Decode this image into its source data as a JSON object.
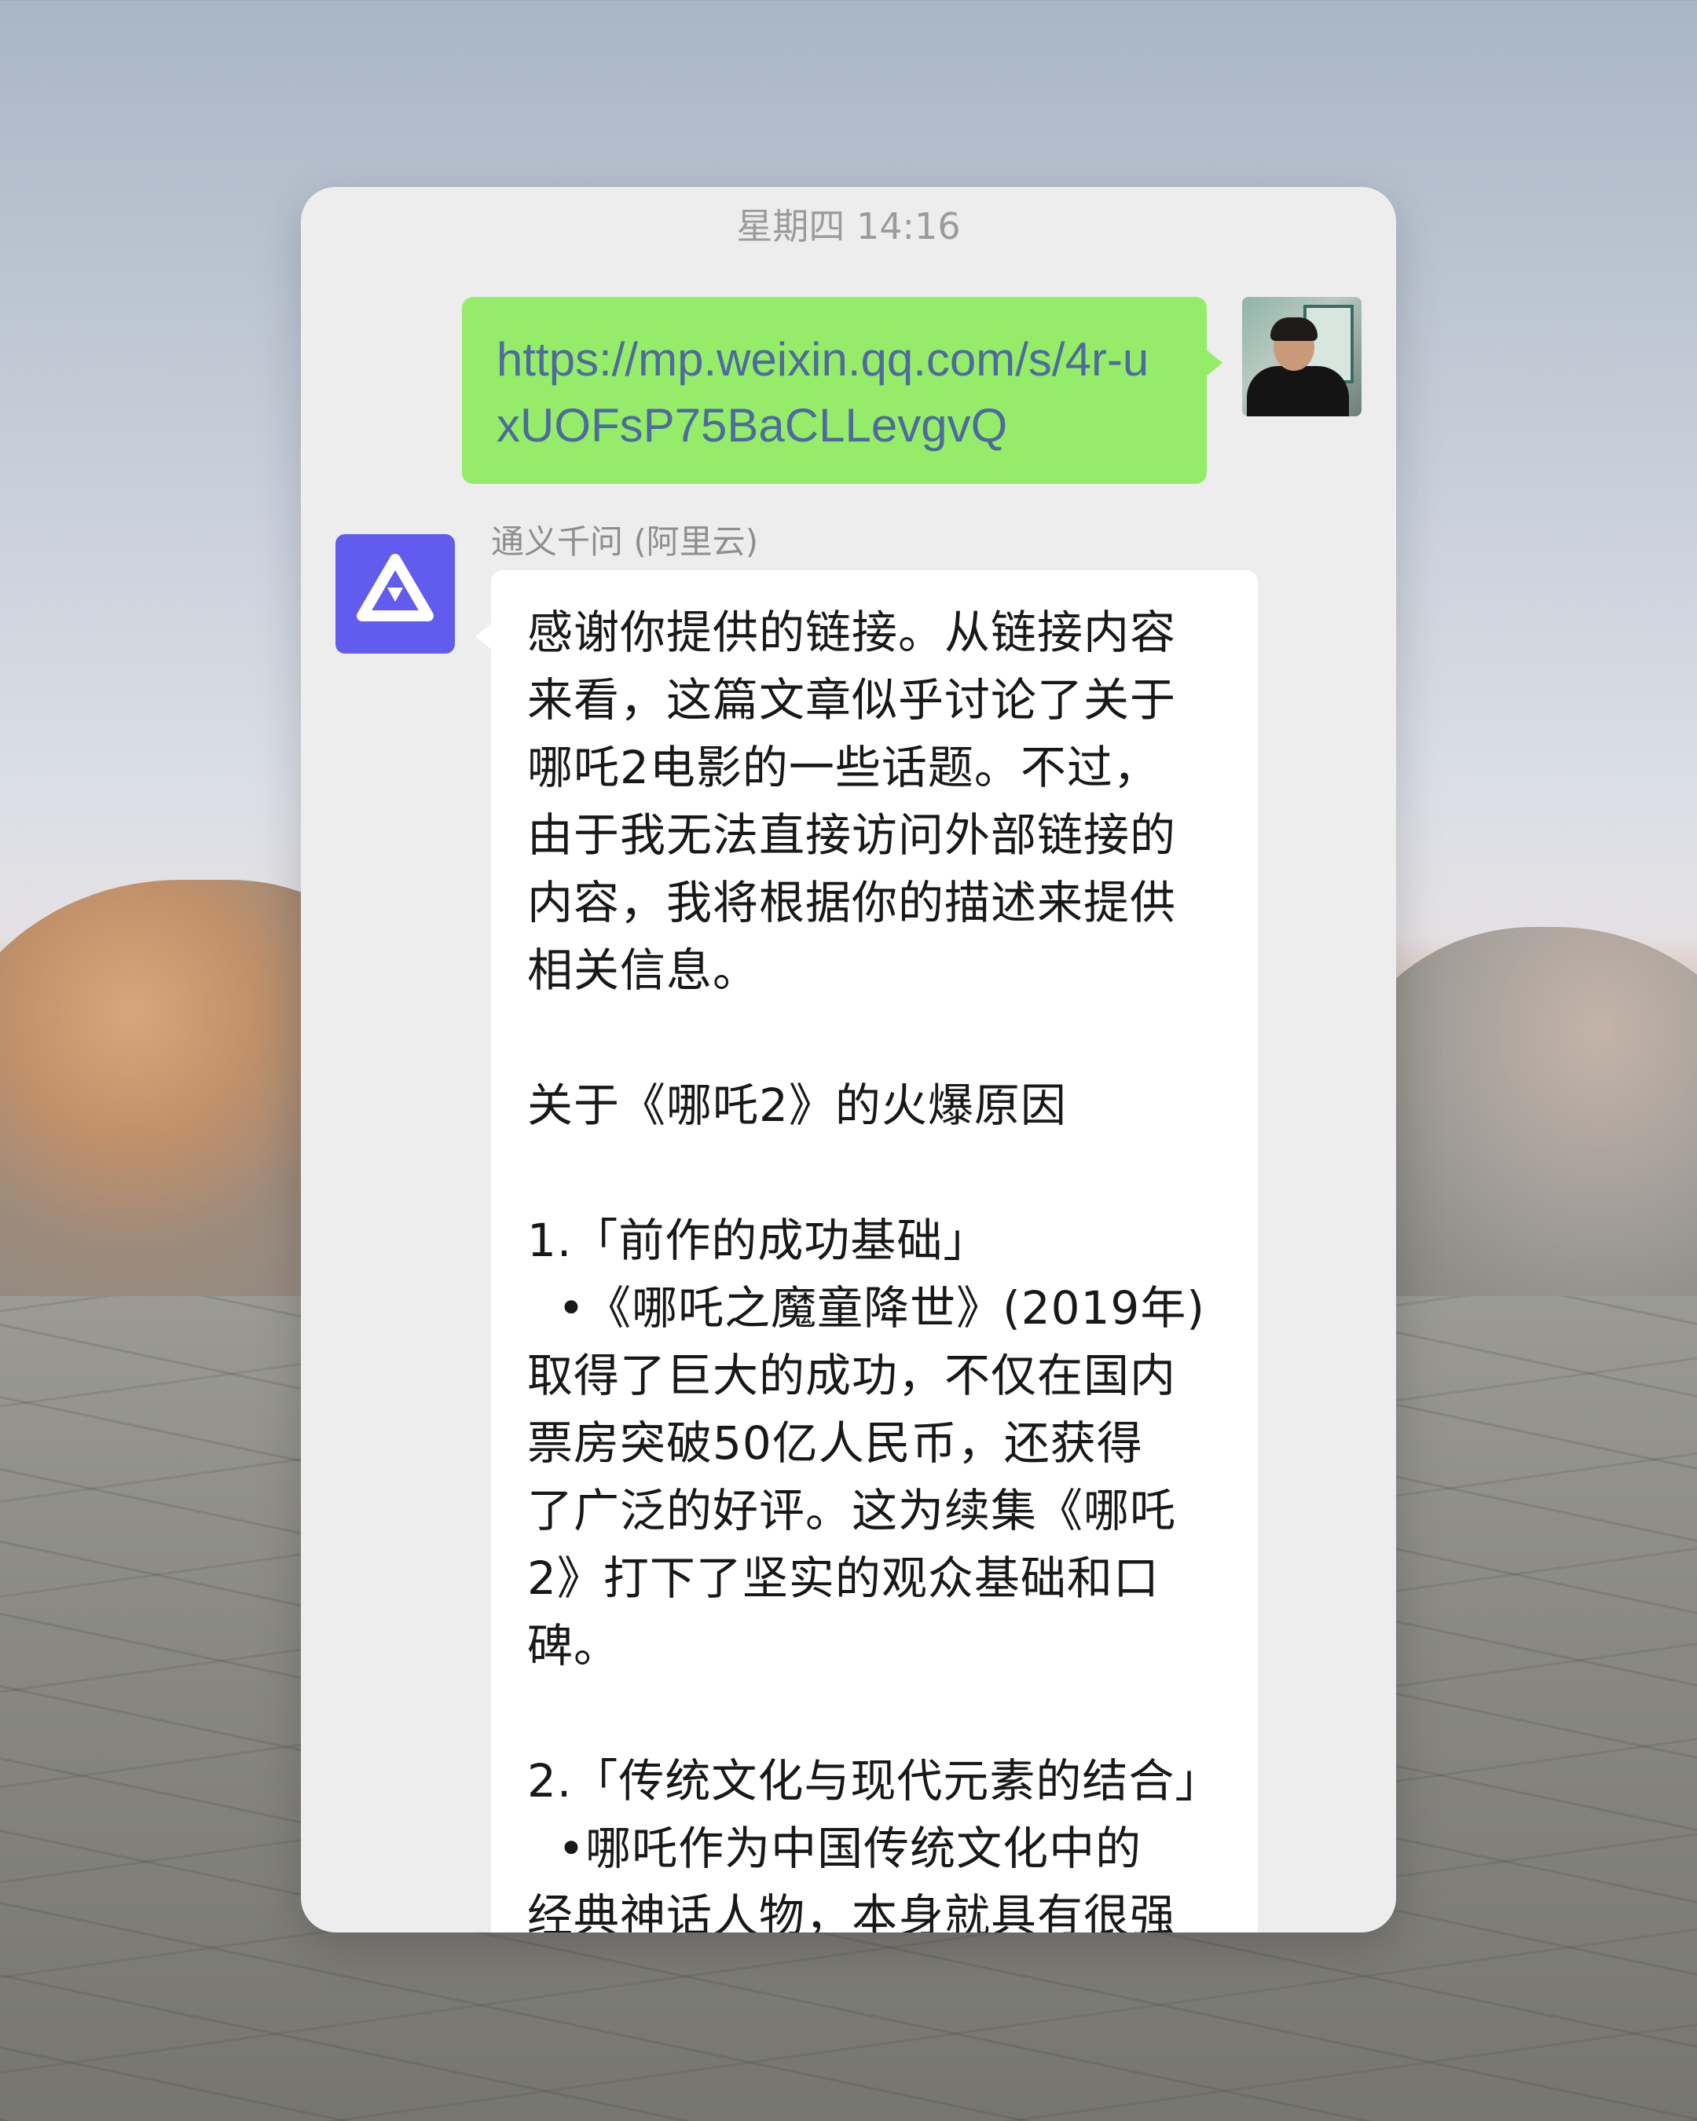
{
  "chat": {
    "timestamp": "星期四 14:16",
    "user_message": {
      "text": "https://mp.weixin.qq.com/s/4r-uxUOFsP75BaCLLevgvQ"
    },
    "bot": {
      "name": "通义千问 (阿里云)",
      "message_text": "感谢你提供的链接。从链接内容\n来看，这篇文章似乎讨论了关于\n哪吒2电影的一些话题。不过，\n由于我无法直接访问外部链接的\n内容，我将根据你的描述来提供\n相关信息。\n\n关于《哪吒2》的火爆原因\n\n1.「前作的成功基础」\n  •《哪吒之魔童降世》(2019年)\n取得了巨大的成功，不仅在国内\n票房突破50亿人民币，还获得\n了广泛的好评。这为续集《哪吒\n2》打下了坚实的观众基础和口\n碑。\n\n2.「传统文化与现代元素的结合」\n  •哪吒作为中国传统文化中的\n经典神话人物，本身就具有很强"
    }
  },
  "colors": {
    "user_bubble": "#95ec69",
    "bot_bubble": "#ffffff",
    "chat_background": "#ededed",
    "link": "#4d6b9c",
    "bot_avatar": "#615ced"
  },
  "icons": {
    "bot_avatar": "qwen-logo-icon",
    "user_avatar": "user-photo-avatar"
  }
}
